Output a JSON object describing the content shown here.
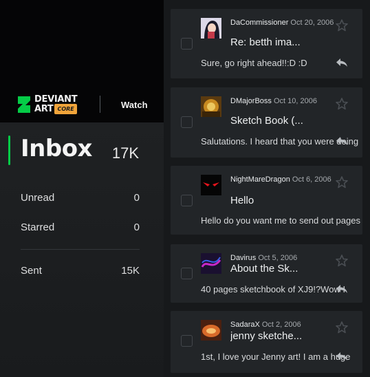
{
  "brand": {
    "line1": "DEVIANT",
    "line2": "ART",
    "badge": "CORE",
    "mark_color": "#05cc47"
  },
  "header": {
    "watch_label": "Watch"
  },
  "inbox": {
    "title": "Inbox",
    "count": "17K",
    "accent_color": "#05cc47",
    "folders": [
      {
        "label": "Unread",
        "count": "0"
      },
      {
        "label": "Starred",
        "count": "0"
      },
      {
        "label": "Sent",
        "count": "15K"
      }
    ]
  },
  "messages": [
    {
      "sender": "DaCommissioner",
      "date": "Oct 20, 2006",
      "subject": "Re: betth ima...",
      "preview": "Sure, go right ahead!!:D :D",
      "avatar": "avatar-1"
    },
    {
      "sender": "DMajorBoss",
      "date": "Oct 10, 2006",
      "subject": "Sketch Book (...",
      "preview": "Salutations. I heard that you were doing",
      "avatar": "avatar-2"
    },
    {
      "sender": "NightMareDragon",
      "date": "Oct 6, 2006",
      "subject": "Hello",
      "preview": "Hello do you want me to send out pages",
      "avatar": "avatar-3"
    },
    {
      "sender": "Davirus",
      "date": "Oct 5, 2006",
      "subject": "About the Sk...",
      "preview": "40 pages sketchbook of XJ9!?Wow I",
      "avatar": "avatar-4"
    },
    {
      "sender": "SadaraX",
      "date": "Oct 2, 2006",
      "subject": "jenny sketche...",
      "preview": "1st, I love your Jenny art! I am a huge",
      "avatar": "avatar-5"
    }
  ]
}
